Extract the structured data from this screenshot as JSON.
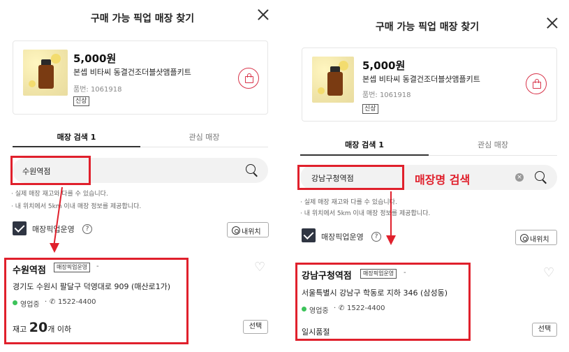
{
  "colors": {
    "accent_red": "#e0202c",
    "open_green": "#3cc35a",
    "checkbox": "#2f3542"
  },
  "left": {
    "title": "구매 가능 픽업 매장 찾기",
    "product": {
      "price": "5,000원",
      "name": "본셉 비타씨 동결건조더블샷앰플키트",
      "code": "품번: 1061918",
      "badge": "신상"
    },
    "tabs": [
      {
        "label": "매장 검색 1"
      },
      {
        "label": "관심 매장"
      }
    ],
    "search": {
      "value": "수원역점"
    },
    "notes": [
      "· 실제 매장 재고와 다를 수 있습니다.",
      "· 내 위치에서 5km 이내 매장 정보를 제공합니다."
    ],
    "filter": {
      "label": "매장픽업운영",
      "help": "?",
      "location_button": "내위치"
    },
    "store": {
      "name": "수원역점",
      "badge": "매장픽업운영",
      "dash": "-",
      "address": "경기도 수원시 팔달구 덕영대로 909 (매산로1가)",
      "status": "영업중",
      "phone": "1522-4400",
      "stock_prefix": "재고 ",
      "stock_number": "20",
      "stock_suffix": "개 이하",
      "select_button": "선택"
    }
  },
  "right": {
    "title": "구매 가능 픽업 매장 찾기",
    "product": {
      "price": "5,000원",
      "name": "본셉 비타씨 동결건조더블샷앰플키트",
      "code": "품번: 1061918",
      "badge": "신상"
    },
    "tabs": [
      {
        "label": "매장 검색 1"
      },
      {
        "label": "관심 매장"
      }
    ],
    "search": {
      "value": "강남구청역점",
      "annotation": "매장명 검색"
    },
    "notes": [
      "· 실제 매장 재고와 다를 수 있습니다.",
      "· 내 위치에서 5km 이내 매장 정보를 제공합니다."
    ],
    "filter": {
      "label": "매장픽업운영",
      "help": "?",
      "location_button": "내위치"
    },
    "store": {
      "name": "강남구청역점",
      "badge": "매장픽업운영",
      "dash": "-",
      "address": "서울특별시 강남구 학동로 지하 346 (삼성동)",
      "status": "영업중",
      "phone": "1522-4400",
      "stock_status": "일시품절",
      "select_button": "선택"
    }
  }
}
